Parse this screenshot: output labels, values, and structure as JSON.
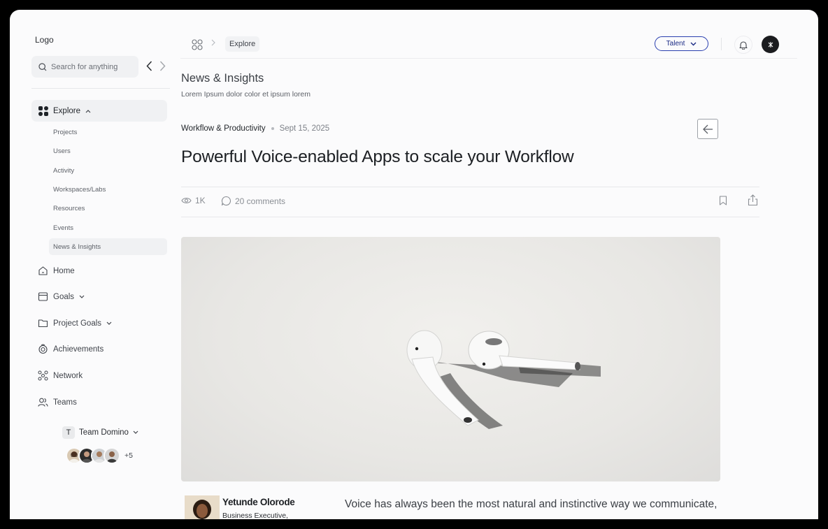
{
  "sidebar": {
    "logo": "Logo",
    "search_placeholder": "Search for anything",
    "explore_label": "Explore",
    "sub_items": [
      "Projects",
      "Users",
      "Activity",
      "Workspaces/Labs",
      "Resources",
      "Events",
      "News & Insights"
    ],
    "active_sub_item": "News & Insights",
    "main_items": [
      {
        "label": "Home",
        "icon": "home-icon"
      },
      {
        "label": "Goals",
        "icon": "calendar-icon",
        "expandable": true
      },
      {
        "label": "Project Goals",
        "icon": "folder-icon",
        "expandable": true
      },
      {
        "label": "Achievements",
        "icon": "badge-icon"
      },
      {
        "label": "Network",
        "icon": "network-icon"
      },
      {
        "label": "Teams",
        "icon": "users-icon"
      }
    ],
    "team": {
      "initial": "T",
      "name": "Team Domino",
      "more_count": "+5"
    }
  },
  "topbar": {
    "breadcrumb": "Explore",
    "role_switch": "Talent"
  },
  "article": {
    "page_title": "News & Insights",
    "page_subtitle": "Lorem Ipsum dolor color et ipsum lorem",
    "category": "Workflow & Productivity",
    "date": "Sept 15, 2025",
    "headline": "Powerful Voice-enabled Apps to scale your Workflow",
    "views": "1K",
    "comments": "20 comments",
    "author_name": "Yetunde Olorode",
    "author_role": "Business Executive,",
    "body_start": "Voice has always been the most natural and instinctive way we communicate,"
  },
  "colors": {
    "accent": "#2a3faf",
    "background": "#fbfbfc",
    "active_bg": "#f0f1f3"
  }
}
